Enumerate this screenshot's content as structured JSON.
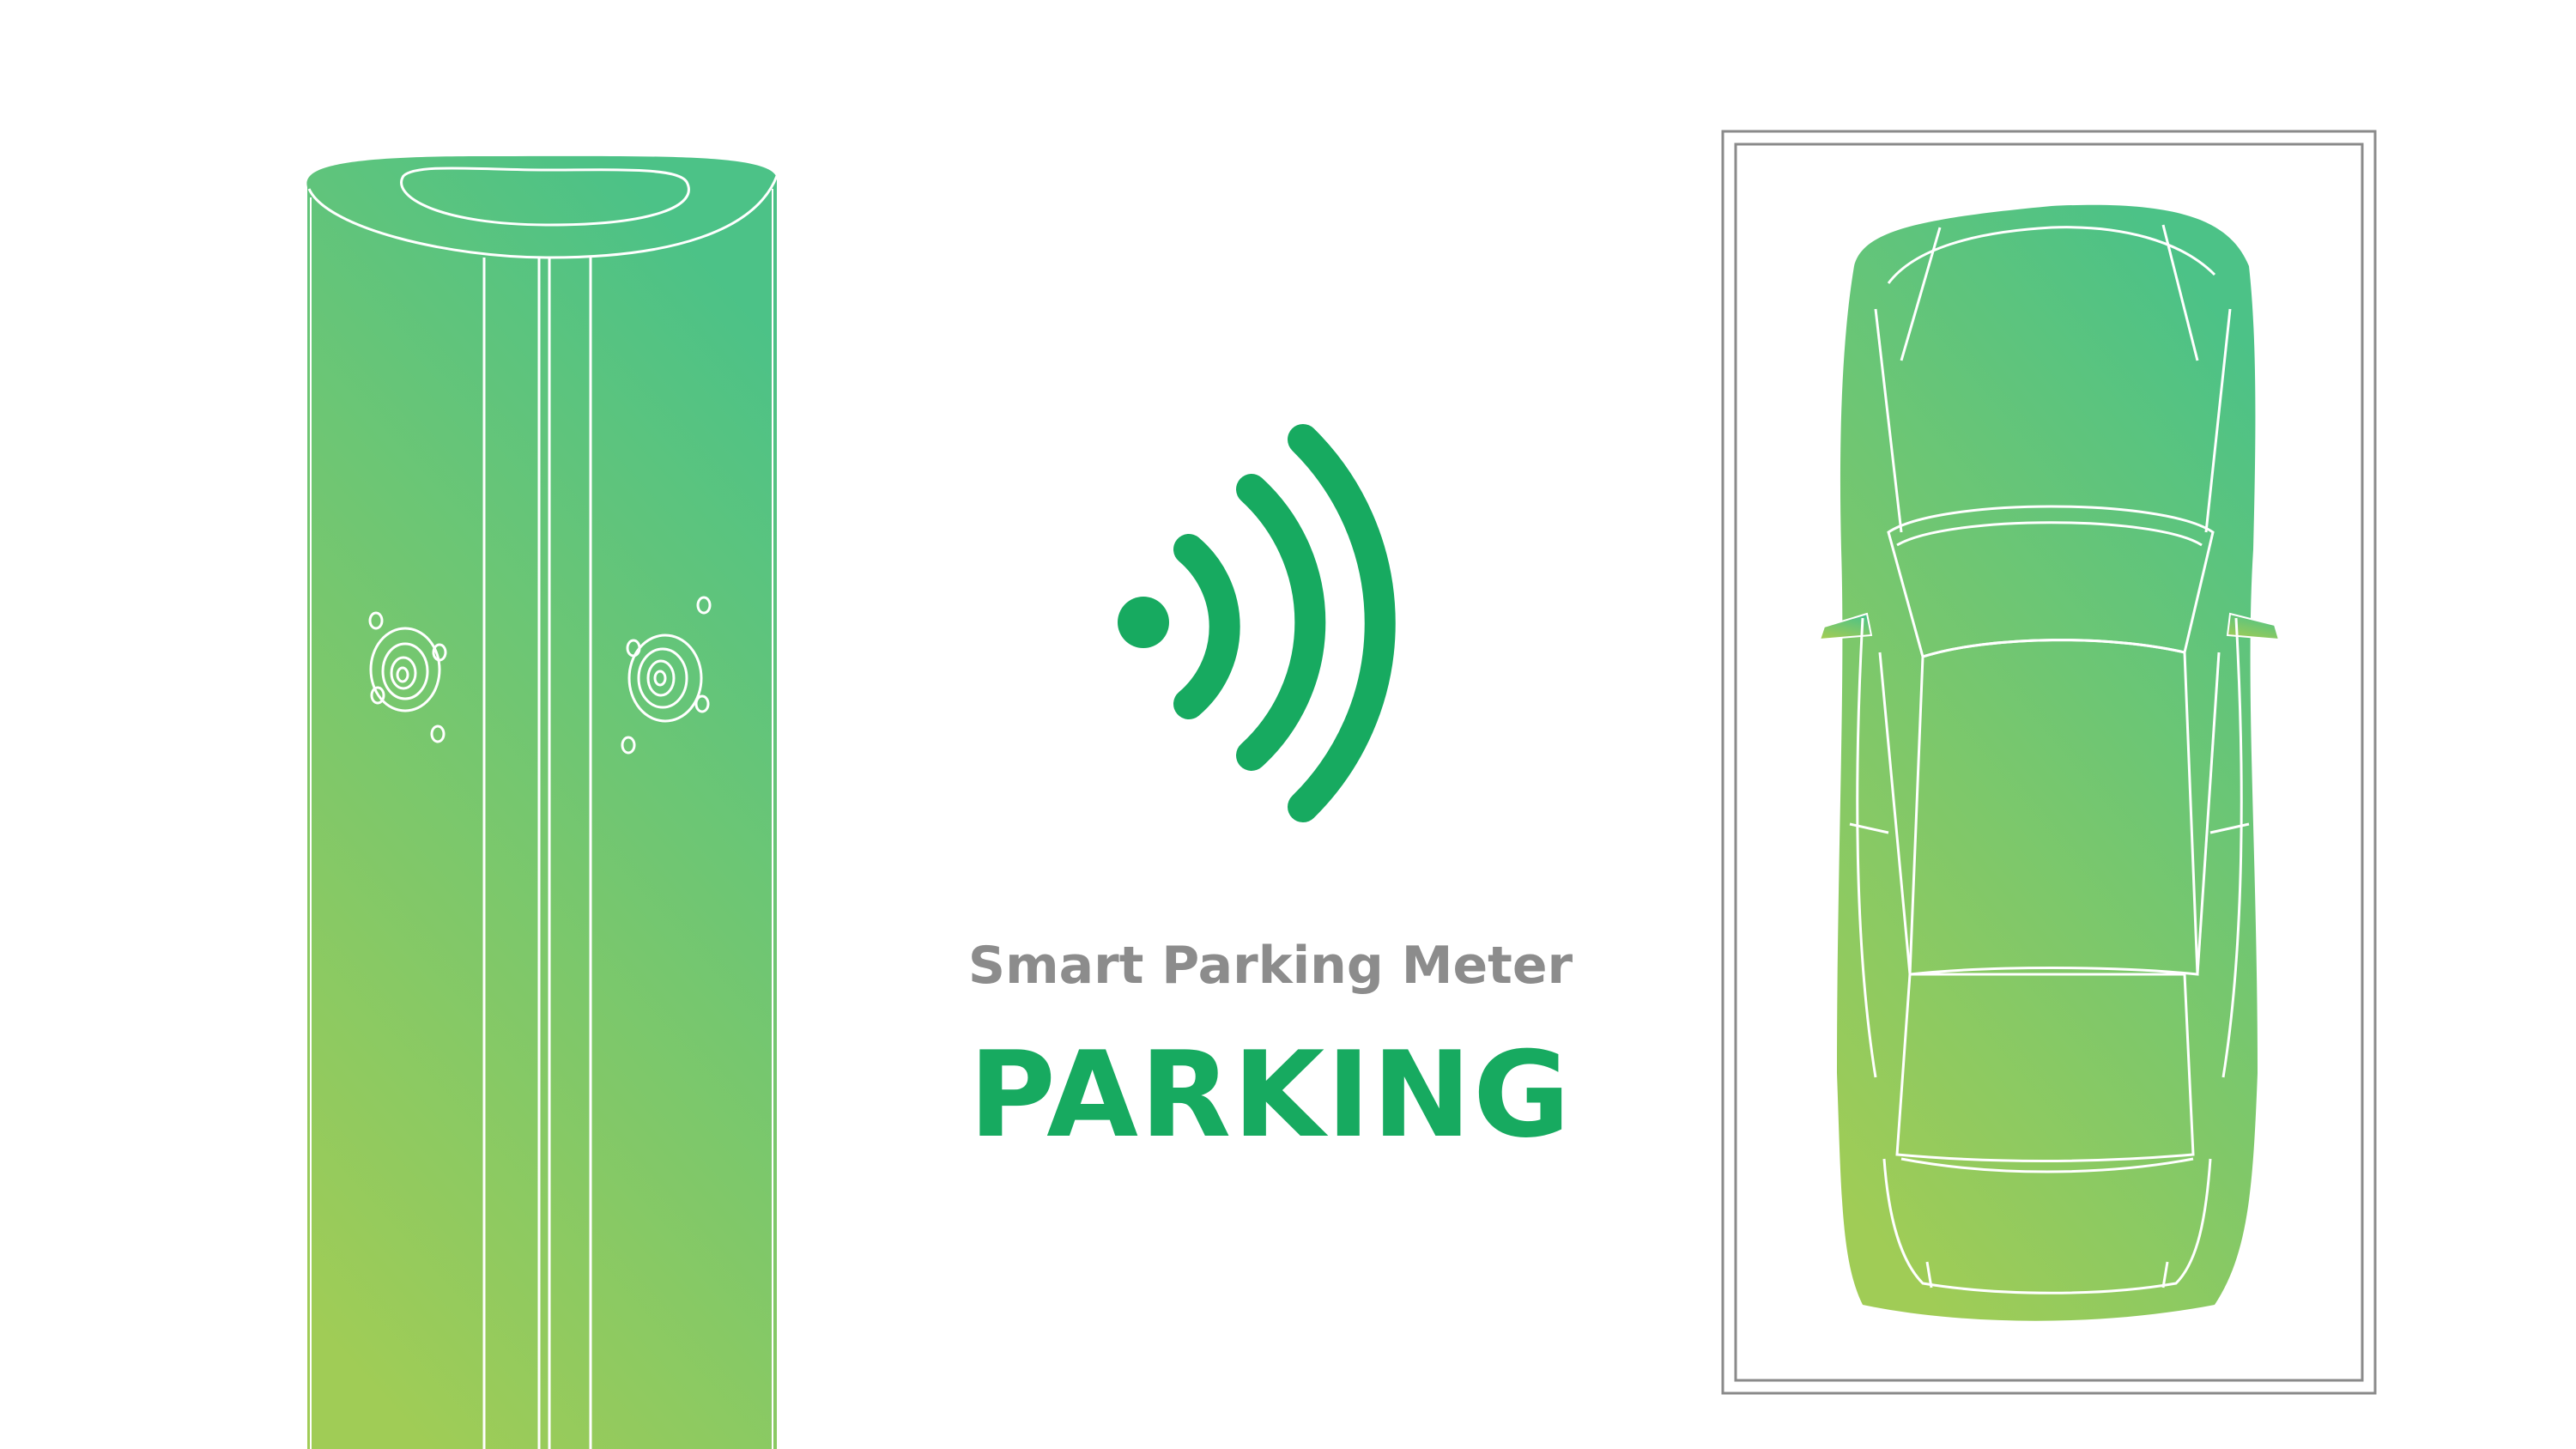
{
  "texts": {
    "subtitle": "Smart Parking Meter",
    "title": "PARKING"
  },
  "colors": {
    "gradient_top": "#4cc287",
    "gradient_bottom": "#a0cc56",
    "signal_green": "#17aa60",
    "subtitle_gray": "#8c8c8c",
    "frame_gray": "#8a8a8a",
    "background": "#ffffff"
  },
  "icons": {
    "meter": "smart-parking-meter-illustration",
    "signal": "wireless-signal-icon",
    "car": "car-top-view-illustration",
    "parking_space": "parking-space-frame"
  }
}
